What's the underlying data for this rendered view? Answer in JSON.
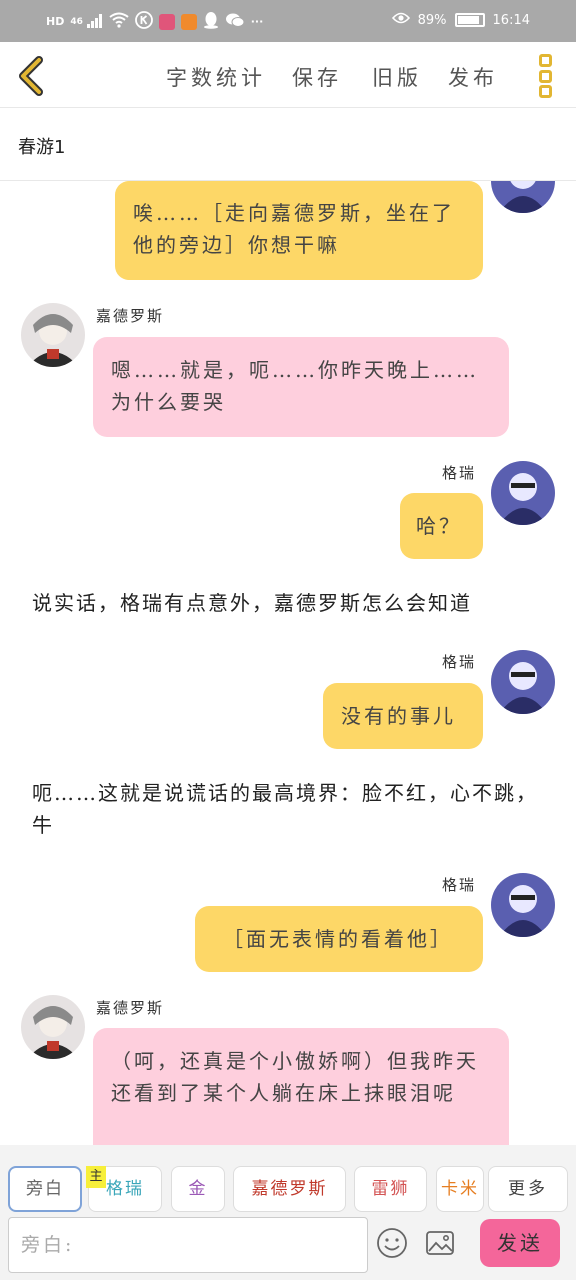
{
  "status_bar": {
    "left_icons": [
      "hd-icon",
      "4g-signal-icon",
      "wifi-icon",
      "k-app-icon",
      "store-app-icon",
      "video-app-icon",
      "qq-icon",
      "wechat-icon",
      "more-dots-icon"
    ],
    "hd_label": "HD",
    "net_label": "46",
    "more_label": "···",
    "battery_percent": "89%",
    "battery_level": 0.89,
    "time": "16:14"
  },
  "toolbar": {
    "word_count": "字数统计",
    "save": "保存",
    "old_version": "旧版",
    "publish": "发布",
    "accent_color": "#e2b632"
  },
  "title": "春游1",
  "messages": [
    {
      "type": "right",
      "speaker": "",
      "text": "唉……［走向嘉德罗斯，坐在了他的旁边］你想干嘛",
      "color": "#fdd767"
    },
    {
      "type": "left",
      "speaker": "嘉德罗斯",
      "text": "嗯……就是，呃……你昨天晚上……为什么要哭",
      "color": "#fecfdd"
    },
    {
      "type": "right",
      "speaker": "格瑞",
      "text": "哈？",
      "color": "#fdd767"
    },
    {
      "type": "narration",
      "text": "说实话，格瑞有点意外，嘉德罗斯怎么会知道"
    },
    {
      "type": "right",
      "speaker": "格瑞",
      "text": "没有的事儿",
      "color": "#fdd767"
    },
    {
      "type": "narration",
      "text": "呃……这就是说谎话的最高境界：脸不红，心不跳，牛"
    },
    {
      "type": "right",
      "speaker": "格瑞",
      "text": "［面无表情的看着他］",
      "color": "#fdd767"
    },
    {
      "type": "left",
      "speaker": "嘉德罗斯",
      "text": "（呵，还真是个小傲娇啊）但我昨天还看到了某个人躺在床上抹眼泪呢",
      "color": "#fecfdd"
    }
  ],
  "roles": [
    {
      "label": "旁白",
      "color": "#666666",
      "selected": true
    },
    {
      "label": "格瑞",
      "color": "#3aa6b9",
      "selected": false,
      "badge": "主"
    },
    {
      "label": "金",
      "color": "#9b59b6",
      "selected": false
    },
    {
      "label": "嘉德罗斯",
      "color": "#c0392b",
      "selected": false
    },
    {
      "label": "雷狮",
      "color": "#d35454",
      "selected": false
    },
    {
      "label": "卡米",
      "color": "#e67e22",
      "selected": false
    }
  ],
  "more_label": "更多",
  "input": {
    "placeholder": "旁白:"
  },
  "send_label": "发送"
}
